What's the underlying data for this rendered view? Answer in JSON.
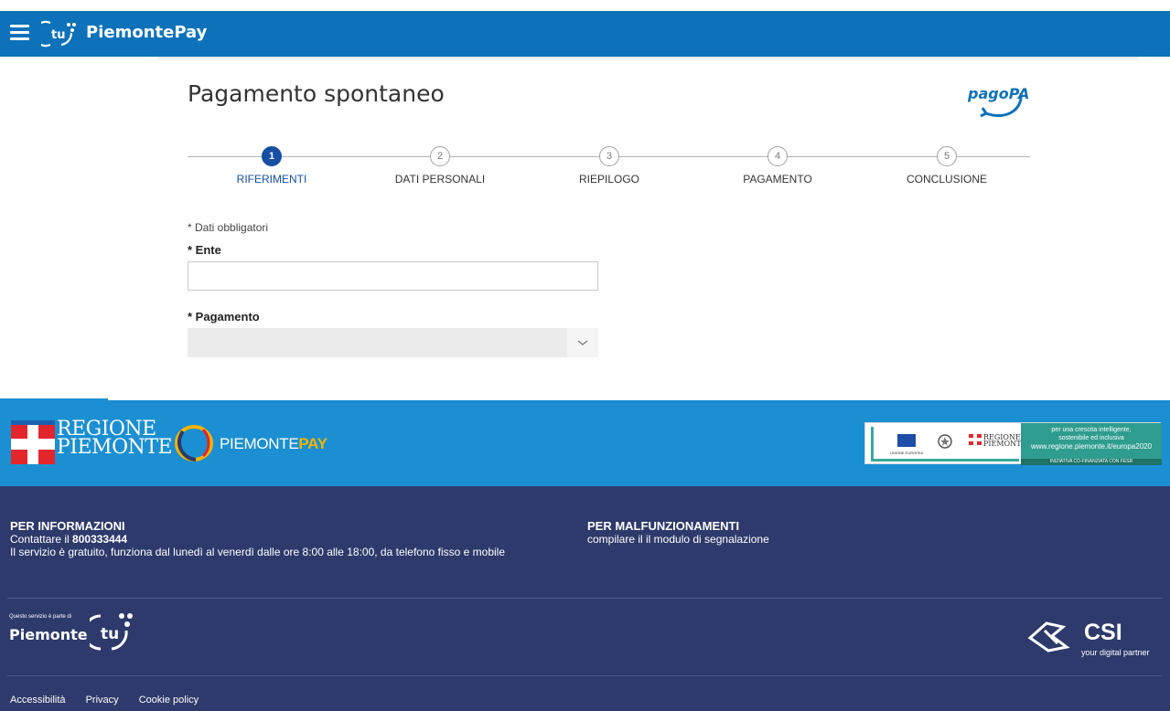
{
  "header": {
    "brand": "PiemontePay",
    "menu_icon": "hamburger-menu-icon",
    "logo_icon": "tu-logo-icon",
    "color": "#0d72b9"
  },
  "main": {
    "title": "Pagamento spontaneo",
    "pagopa_logo": "pagoPA",
    "steps": [
      {
        "number": "1",
        "label": "RIFERIMENTI",
        "active": true
      },
      {
        "number": "2",
        "label": "DATI PERSONALI",
        "active": false
      },
      {
        "number": "3",
        "label": "RIEPILOGO",
        "active": false
      },
      {
        "number": "4",
        "label": "PAGAMENTO",
        "active": false
      },
      {
        "number": "5",
        "label": "CONCLUSIONE",
        "active": false
      }
    ],
    "required_note": "* Dati obbligatori",
    "ente_label": "* Ente",
    "ente_value": "",
    "pagamento_label": "* Pagamento",
    "pagamento_value": "",
    "accent_color": "#164fa2"
  },
  "footer": {
    "regione_logo_line1": "REGIONE",
    "regione_logo_line2": "PIEMONTE",
    "piemontepay_logo_a": "PIEMONTE",
    "piemontepay_logo_b": "PAY",
    "eu_banner": {
      "flag_caption": "UNIONE EUROPEA",
      "regione_line1": "REGIONE",
      "regione_line2": "PIEMONTE",
      "line1": "per una crescita intelligente,",
      "line2": "sostenibile ed inclusiva",
      "url": "www.regione.piemonte.it/europa2020",
      "strip": "INIZIATIVA CO-FINANZIATA CON FESR"
    },
    "info": {
      "head": "PER INFORMAZIONI",
      "contact_prefix": "Contattare il ",
      "phone": "800333444",
      "note": "Il servizio è gratuito, funziona dal lunedì al venerdì dalle ore 8:00 alle 18:00, da telefono fisso e mobile"
    },
    "malfunzionamenti": {
      "head": "PER MALFUNZIONAMENTI",
      "text": "compilare il il modulo di segnalazione"
    },
    "piemonte_tu_small": "Questo servizio è parte di",
    "piemonte_tu_name": "Piemonte",
    "csi_name": "CSI",
    "csi_tagline": "your digital partner",
    "links": [
      "Accessibilità",
      "Privacy",
      "Cookie policy"
    ],
    "band_color": "#1b8fd2",
    "info_color": "#2e3a6b"
  }
}
